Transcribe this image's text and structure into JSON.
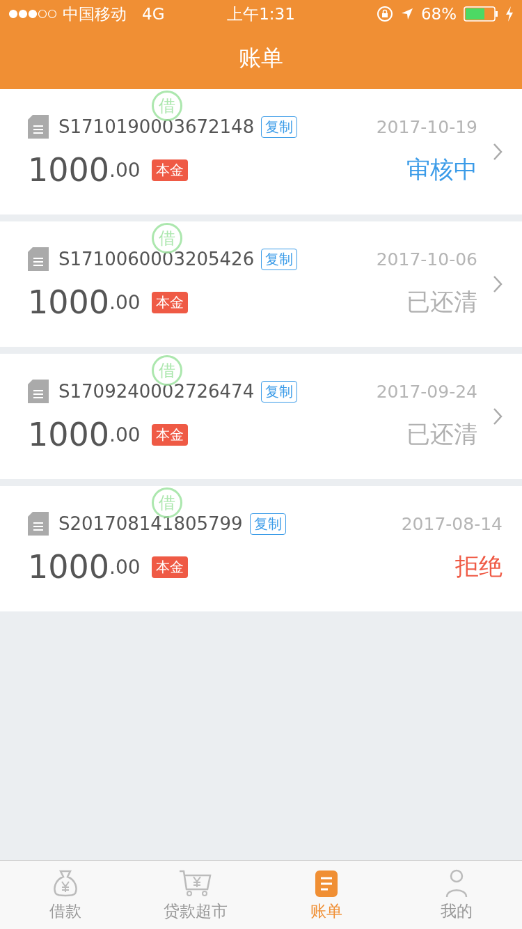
{
  "status_bar": {
    "carrier": "中国移动",
    "network": "4G",
    "time": "上午1:31",
    "battery": "68%",
    "charging": true
  },
  "header": {
    "title": "账单"
  },
  "bills": [
    {
      "id": "S1710190003672148",
      "copy": "复制",
      "date": "2017-10-19",
      "amount": "1000",
      "decimals": ".00",
      "tag": "本金",
      "stamp": "借",
      "status": "审核中",
      "color": "#3a9be8",
      "has_arrow": true
    },
    {
      "id": "S1710060003205426",
      "copy": "复制",
      "date": "2017-10-06",
      "amount": "1000",
      "decimals": ".00",
      "tag": "本金",
      "stamp": "借",
      "status": "已还清",
      "color": "#b0b0b0",
      "has_arrow": true
    },
    {
      "id": "S1709240002726474",
      "copy": "复制",
      "date": "2017-09-24",
      "amount": "1000",
      "decimals": ".00",
      "tag": "本金",
      "stamp": "借",
      "status": "已还清",
      "color": "#b0b0b0",
      "has_arrow": true
    },
    {
      "id": "S201708141805799",
      "copy": "复制",
      "date": "2017-08-14",
      "amount": "1000",
      "decimals": ".00",
      "tag": "本金",
      "stamp": "借",
      "status": "拒绝",
      "color": "#ef5a45",
      "has_arrow": false
    }
  ],
  "tabs": [
    {
      "label": "借款",
      "kind": "loan",
      "selected": false
    },
    {
      "label": "贷款超市",
      "kind": "market",
      "selected": false
    },
    {
      "label": "账单",
      "kind": "bills",
      "selected": true
    },
    {
      "label": "我的",
      "kind": "profile",
      "selected": false
    }
  ]
}
